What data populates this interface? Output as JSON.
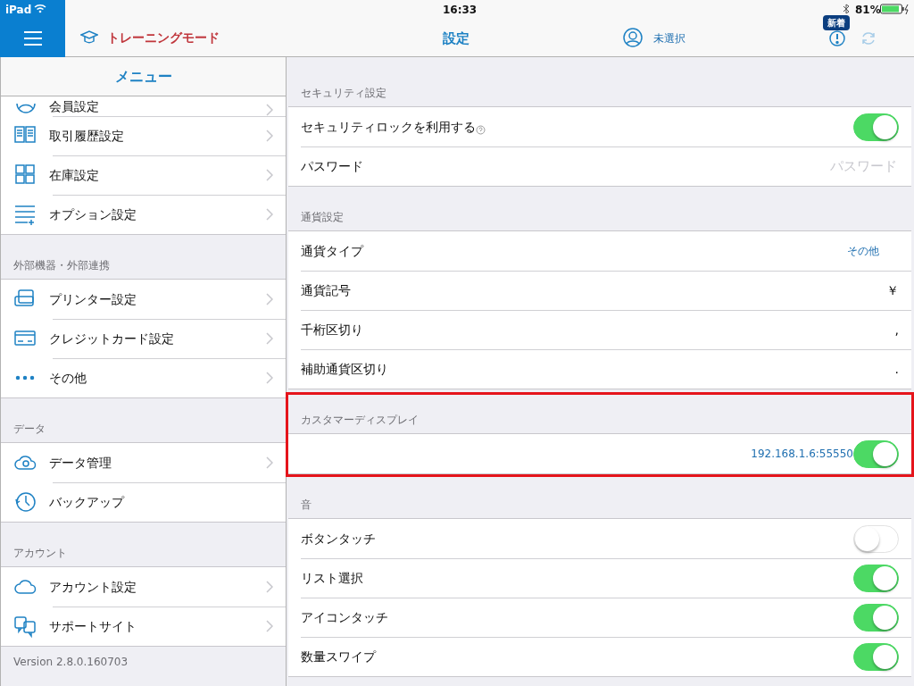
{
  "status_bar": {
    "device": "iPad",
    "time": "16:33",
    "battery": "81%"
  },
  "header": {
    "mode": "トレーニングモード",
    "title": "設定",
    "user": "未選択",
    "badge": "新着"
  },
  "menu": {
    "title": "メニュー",
    "sections": [
      {
        "items": [
          {
            "label": "会員設定",
            "chevron": true
          },
          {
            "label": "取引履歴設定",
            "chevron": true
          },
          {
            "label": "在庫設定",
            "chevron": true
          },
          {
            "label": "オプション設定",
            "chevron": true
          }
        ]
      },
      {
        "header": "外部機器・外部連携",
        "items": [
          {
            "label": "プリンター設定",
            "chevron": true
          },
          {
            "label": "クレジットカード設定",
            "chevron": true
          },
          {
            "label": "その他",
            "chevron": true
          }
        ]
      },
      {
        "header": "データ",
        "items": [
          {
            "label": "データ管理",
            "chevron": true
          },
          {
            "label": "バックアップ",
            "chevron": false
          }
        ]
      },
      {
        "header": "アカウント",
        "items": [
          {
            "label": "アカウント設定",
            "chevron": true
          },
          {
            "label": "サポートサイト",
            "chevron": true
          }
        ]
      }
    ],
    "version": "Version 2.8.0.160703"
  },
  "settings": [
    {
      "header": "セキュリティ設定",
      "highlighted": false,
      "rows": [
        {
          "kind": "toggle",
          "label": "セキュリティロックを利用する",
          "help": true,
          "on": true
        },
        {
          "kind": "input",
          "label": "パスワード",
          "placeholder": "パスワード"
        }
      ]
    },
    {
      "header": "通貨設定",
      "highlighted": false,
      "rows": [
        {
          "kind": "select",
          "label": "通貨タイプ",
          "value": "その他"
        },
        {
          "kind": "value",
          "label": "通貨記号",
          "value": "￥"
        },
        {
          "kind": "value",
          "label": "千桁区切り",
          "value": ","
        },
        {
          "kind": "value",
          "label": "補助通貨区切り",
          "value": "."
        }
      ]
    },
    {
      "header": "カスタマーディスプレイ",
      "highlighted": true,
      "rows": [
        {
          "kind": "toggle",
          "value": "192.168.1.6:55550",
          "on": true
        }
      ]
    },
    {
      "header": "音",
      "highlighted": false,
      "rows": [
        {
          "kind": "toggle",
          "label": "ボタンタッチ",
          "on": false
        },
        {
          "kind": "toggle",
          "label": "リスト選択",
          "on": true
        },
        {
          "kind": "toggle",
          "label": "アイコンタッチ",
          "on": true
        },
        {
          "kind": "toggle",
          "label": "数量スワイプ",
          "on": true
        }
      ]
    }
  ]
}
